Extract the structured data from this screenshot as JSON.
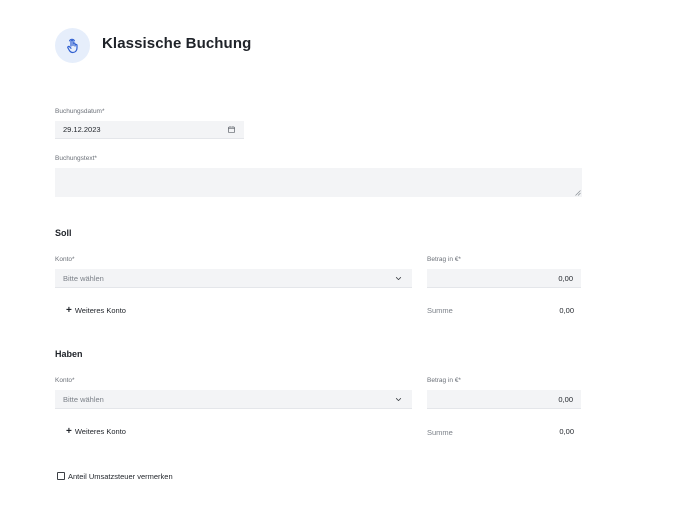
{
  "header": {
    "title": "Klassische Buchung",
    "icon": "hand-pointer-icon"
  },
  "booking_date": {
    "label": "Buchungsdatum*",
    "value": "29.12.2023",
    "icon": "calendar-icon"
  },
  "booking_text": {
    "label": "Buchungstext*",
    "value": ""
  },
  "soll": {
    "title": "Soll",
    "account_label": "Konto*",
    "account_placeholder": "Bitte wählen",
    "amount_label": "Betrag in €*",
    "amount_value": "0,00",
    "add_account": "Weiteres Konto",
    "sum_label": "Summe",
    "sum_value": "0,00"
  },
  "haben": {
    "title": "Haben",
    "account_label": "Konto*",
    "account_placeholder": "Bitte wählen",
    "amount_label": "Betrag in €*",
    "amount_value": "0,00",
    "add_account": "Weiteres Konto",
    "sum_label": "Summe",
    "sum_value": "0,00"
  },
  "vat": {
    "label": "Anteil Umsatzsteuer vermerken",
    "checked": false
  },
  "colors": {
    "accent_bg": "#e6eefb",
    "accent_icon": "#2f5fd0",
    "field_bg": "#f3f4f6"
  }
}
